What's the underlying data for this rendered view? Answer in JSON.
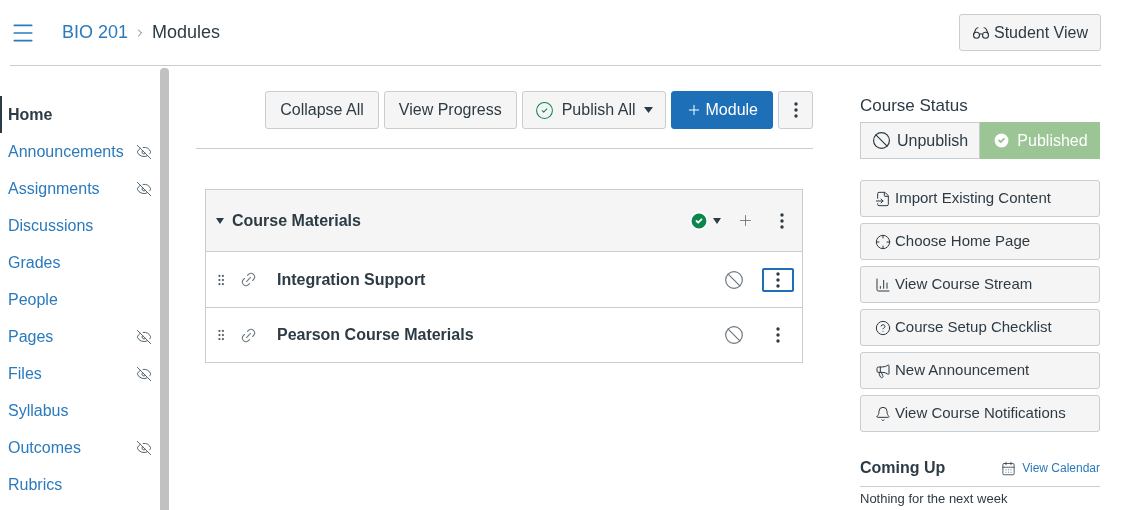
{
  "breadcrumb": {
    "course": "BIO 201",
    "page": "Modules"
  },
  "student_view_button": "Student View",
  "sidebar": {
    "items": [
      {
        "label": "Home",
        "selected": true,
        "hidden": false
      },
      {
        "label": "Announcements",
        "selected": false,
        "hidden": true
      },
      {
        "label": "Assignments",
        "selected": false,
        "hidden": true
      },
      {
        "label": "Discussions",
        "selected": false,
        "hidden": false
      },
      {
        "label": "Grades",
        "selected": false,
        "hidden": false
      },
      {
        "label": "People",
        "selected": false,
        "hidden": false
      },
      {
        "label": "Pages",
        "selected": false,
        "hidden": true
      },
      {
        "label": "Files",
        "selected": false,
        "hidden": true
      },
      {
        "label": "Syllabus",
        "selected": false,
        "hidden": false
      },
      {
        "label": "Outcomes",
        "selected": false,
        "hidden": true
      },
      {
        "label": "Rubrics",
        "selected": false,
        "hidden": false
      }
    ]
  },
  "toolbar": {
    "collapse_all": "Collapse All",
    "view_progress": "View Progress",
    "publish_all": "Publish All",
    "add_module": "Module"
  },
  "module": {
    "title": "Course Materials",
    "expanded": true,
    "published": true,
    "items": [
      {
        "title": "Integration Support",
        "published": false,
        "focused": true
      },
      {
        "title": "Pearson Course Materials",
        "published": false,
        "focused": false
      }
    ]
  },
  "course_status": {
    "title": "Course Status",
    "options": [
      {
        "kind": "unpublish",
        "label": "Unpublish",
        "selected": false
      },
      {
        "kind": "published",
        "label": "Published",
        "selected": true
      }
    ]
  },
  "actions": [
    {
      "kind": "import",
      "label": "Import Existing Content"
    },
    {
      "kind": "home",
      "label": "Choose Home Page"
    },
    {
      "kind": "stream",
      "label": "View Course Stream"
    },
    {
      "kind": "checklist",
      "label": "Course Setup Checklist"
    },
    {
      "kind": "announcement",
      "label": "New Announcement"
    },
    {
      "kind": "notifications",
      "label": "View Course Notifications"
    }
  ],
  "coming_up": {
    "title": "Coming Up",
    "calendar_link": "View Calendar",
    "empty_text": "Nothing for the next week"
  }
}
